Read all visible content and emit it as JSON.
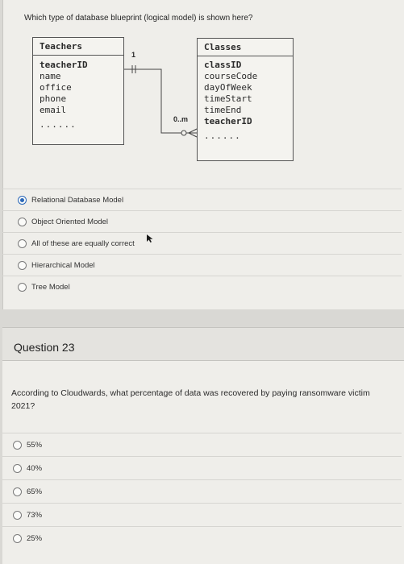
{
  "q22": {
    "prompt": "Which type of database blueprint (logical model) is shown here?",
    "teachers_entity": {
      "title": "Teachers",
      "key_field": "teacherID",
      "fields": [
        "name",
        "office",
        "phone",
        "email"
      ],
      "ellipsis": "......"
    },
    "classes_entity": {
      "title": "Classes",
      "key_field": "classID",
      "fields": [
        "courseCode",
        "dayOfWeek",
        "timeStart",
        "timeEnd"
      ],
      "foreign_key": "teacherID",
      "ellipsis": "......"
    },
    "relationship": {
      "one_label": "1",
      "many_label": "0..m"
    },
    "options": [
      {
        "label": "Relational Database Model",
        "selected": true
      },
      {
        "label": "Object Oriented Model",
        "selected": false
      },
      {
        "label": "All of these are equally correct",
        "selected": false
      },
      {
        "label": "Hierarchical Model",
        "selected": false
      },
      {
        "label": "Tree Model",
        "selected": false
      }
    ]
  },
  "q23": {
    "header": "Question 23",
    "prompt": "According to Cloudwards, what percentage of data was recovered by paying ransomware victim\n2021?",
    "options": [
      {
        "label": "55%"
      },
      {
        "label": "40%"
      },
      {
        "label": "65%"
      },
      {
        "label": "73%"
      },
      {
        "label": "25%"
      }
    ]
  },
  "colors": {
    "accent": "#2a67b8",
    "page_bg": "#efeeea",
    "header_bg": "#e4e3df"
  }
}
